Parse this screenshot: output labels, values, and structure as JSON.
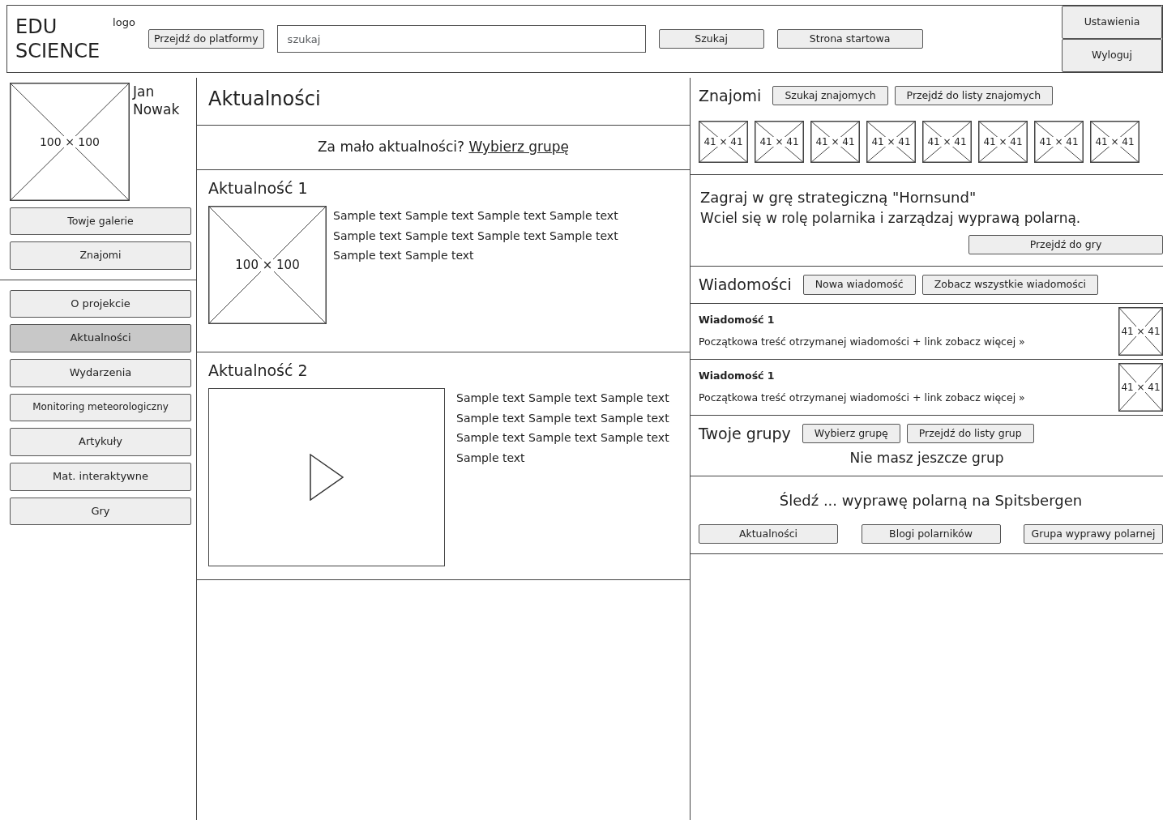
{
  "header": {
    "logo_lines": [
      "EDU",
      "SCIENCE"
    ],
    "logo_label": "logo",
    "platform_button": "Przejdź do platformy",
    "search": {
      "placeholder": "szukaj"
    },
    "search_button": "Szukaj",
    "home_button": "Strona startowa",
    "account_buttons": [
      "Ustawienia",
      "Wyloguj"
    ]
  },
  "sidebar": {
    "avatar_label": "100 × 100",
    "user_name": "Jan Nowak",
    "user_buttons": [
      "Towje galerie",
      "Znajomi"
    ],
    "nav": [
      {
        "label": "O projekcie",
        "selected": false
      },
      {
        "label": "Aktualności",
        "selected": true
      },
      {
        "label": "Wydarzenia",
        "selected": false
      },
      {
        "label": "Monitoring meteorologiczny",
        "selected": false
      },
      {
        "label": "Artykuły",
        "selected": false
      },
      {
        "label": "Mat. interaktywne",
        "selected": false
      },
      {
        "label": "Gry",
        "selected": false
      }
    ]
  },
  "main": {
    "title": "Aktualności",
    "prompt": {
      "text": "Za mało aktualności?",
      "link": "Wybierz grupę"
    },
    "news": [
      {
        "kind": "image",
        "title": "Aktualność 1",
        "image_label": "100 × 100",
        "text": "Sample text Sample text Sample text Sample text Sample text Sample text Sample text Sample text Sample text Sample text"
      },
      {
        "kind": "video",
        "title": "Aktualność 2",
        "text": "Sample text Sample text Sample text Sample text Sample text Sample text Sample text Sample text Sample text Sample text"
      }
    ]
  },
  "right": {
    "friends": {
      "title": "Znajomi",
      "buttons": [
        "Szukaj znajomych",
        "Przejdź do listy znajomych"
      ],
      "thumbnails": [
        "41 × 41",
        "41 × 41",
        "41 × 41",
        "41 × 41",
        "41 × 41",
        "41 × 41",
        "41 × 41",
        "41 × 41"
      ]
    },
    "game": {
      "title": "Zagraj w grę strategiczną \"Hornsund\"",
      "description": "Wciel się w rolę polarnika i zarządzaj wyprawą polarną.",
      "button": "Przejdź do gry"
    },
    "messages": {
      "title": "Wiadomości",
      "buttons": [
        "Nowa wiadomość",
        "Zobacz wszystkie wiadomości"
      ],
      "items": [
        {
          "title": "Wiadomość 1",
          "preview": "Początkowa treść otrzymanej wiadomości + link zobacz więcej »",
          "thumb_label": "41 × 41"
        },
        {
          "title": "Wiadomość 1",
          "preview": "Początkowa treść otrzymanej wiadomości + link zobacz więcej »",
          "thumb_label": "41 × 41"
        }
      ]
    },
    "groups": {
      "title": "Twoje grupy",
      "buttons": [
        "Wybierz grupę",
        "Przejdź do listy grup"
      ],
      "empty_text": "Nie masz jeszcze grup"
    },
    "follow": {
      "title": "Śledź ... wyprawę polarną na Spitsbergen",
      "buttons": [
        "Aktualności",
        "Blogi polarników",
        "Grupa wyprawy polarnej"
      ]
    }
  }
}
